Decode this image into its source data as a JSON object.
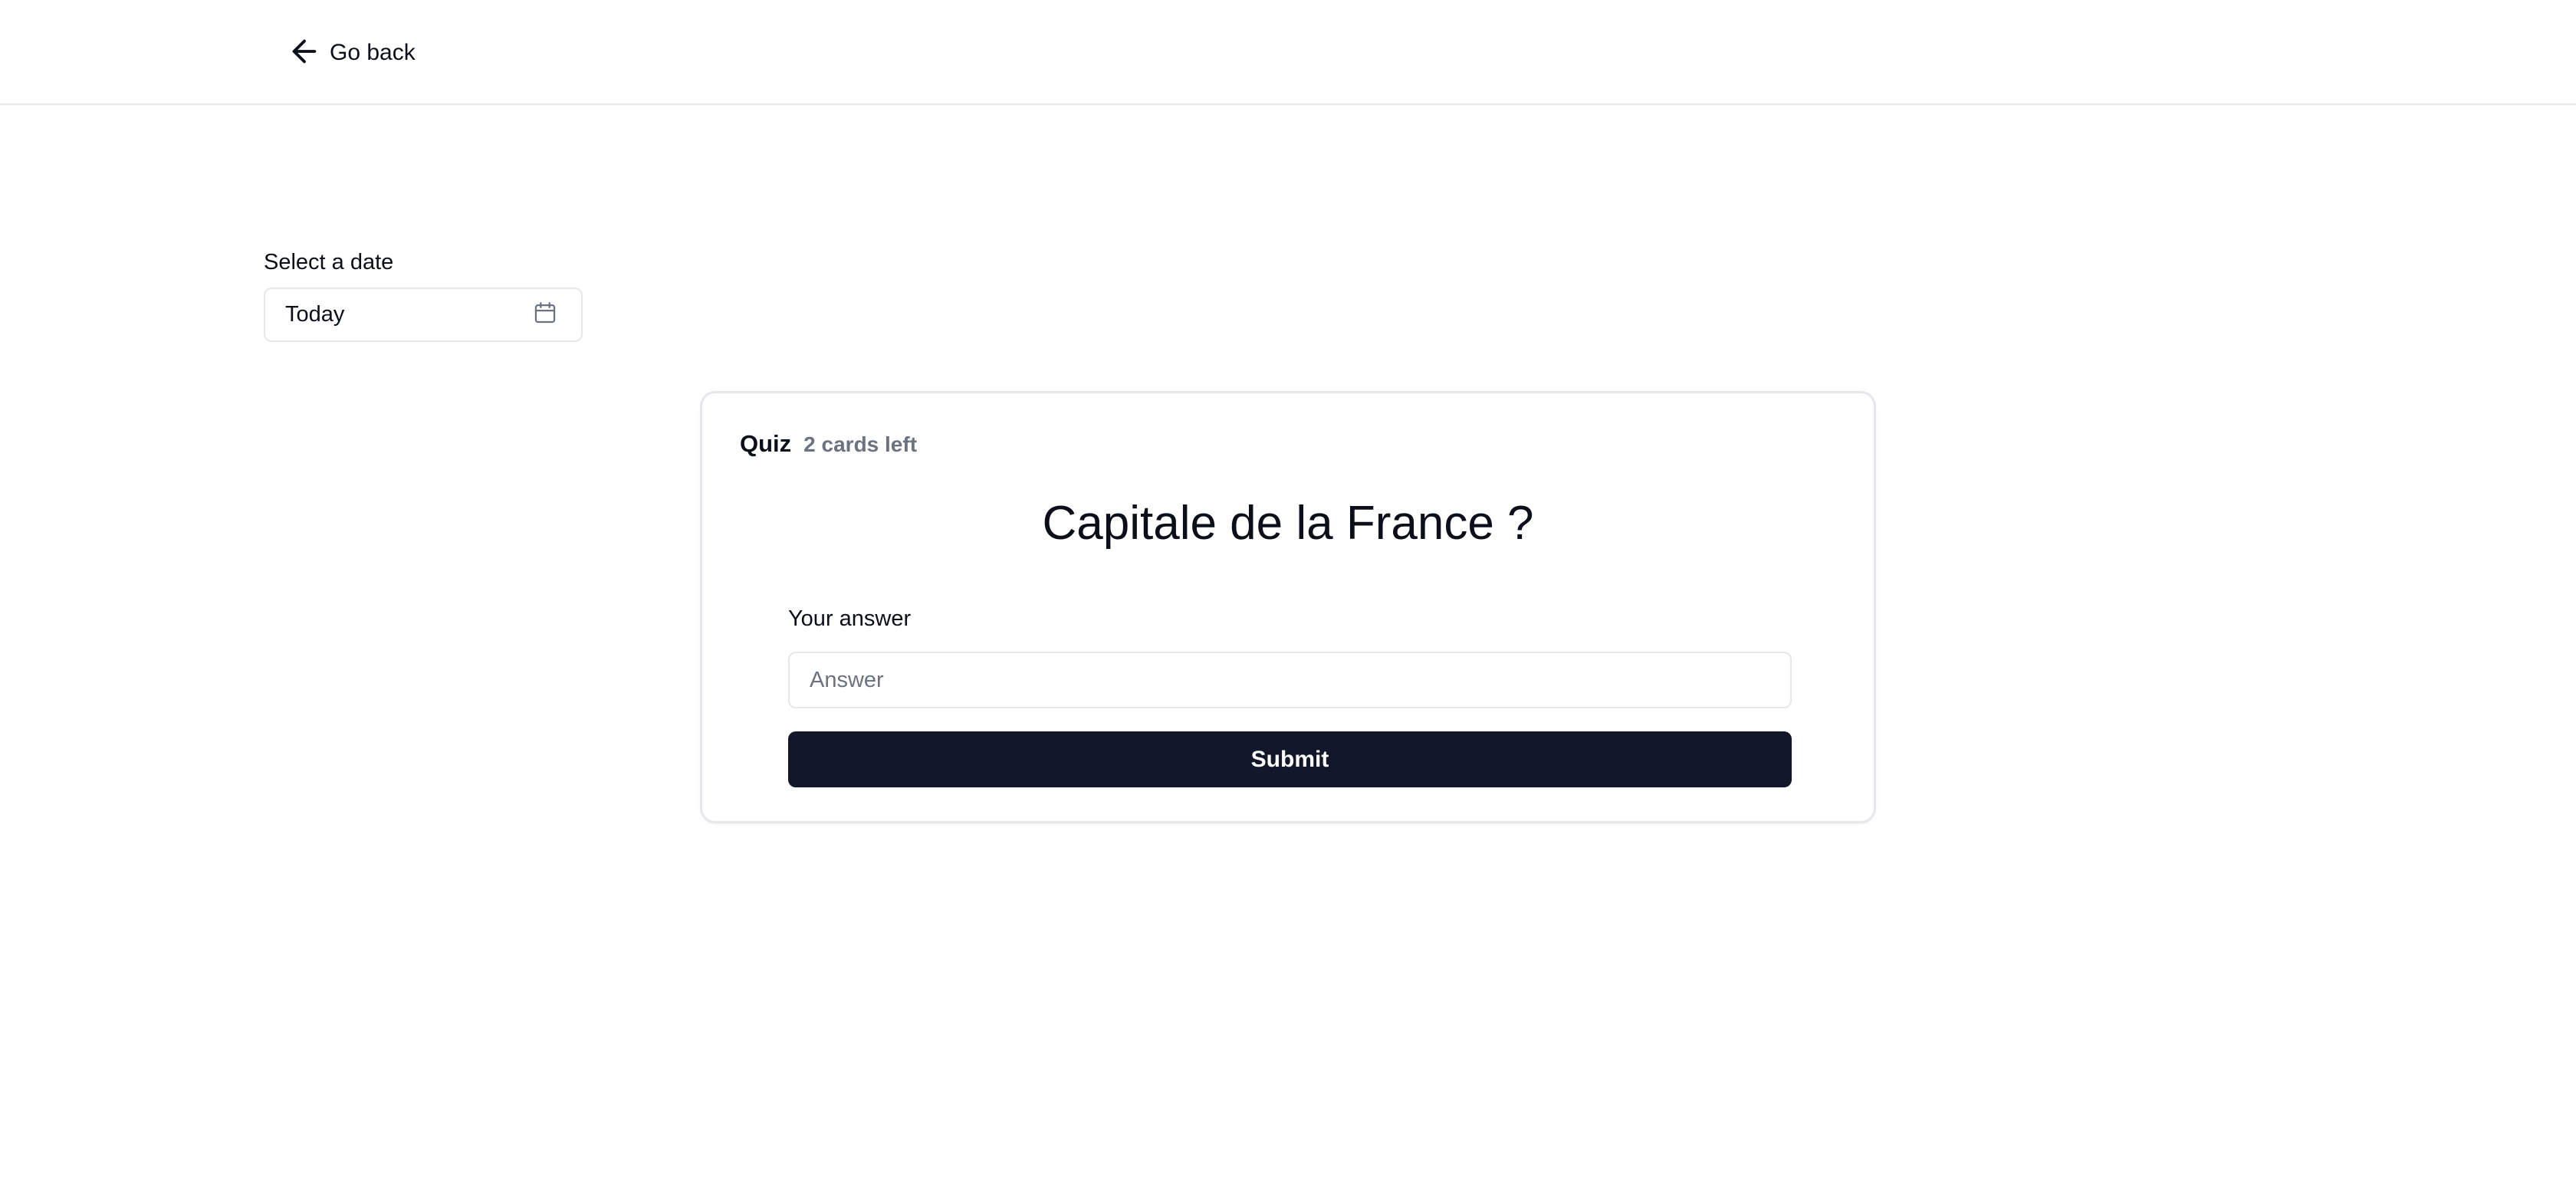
{
  "header": {
    "back_label": "Go back"
  },
  "date": {
    "label": "Select a date",
    "value": "Today"
  },
  "quiz": {
    "title": "Quiz",
    "cards_left": "2 cards left",
    "question": "Capitale de la France ?",
    "answer_label": "Your answer",
    "answer_value": "",
    "answer_placeholder": "Answer",
    "submit_label": "Submit"
  },
  "icons": {
    "back": "arrow-left-icon",
    "calendar": "calendar-icon"
  },
  "colors": {
    "primary_button": "#121829",
    "muted_text": "#6b7280",
    "border": "#e5e7eb"
  }
}
